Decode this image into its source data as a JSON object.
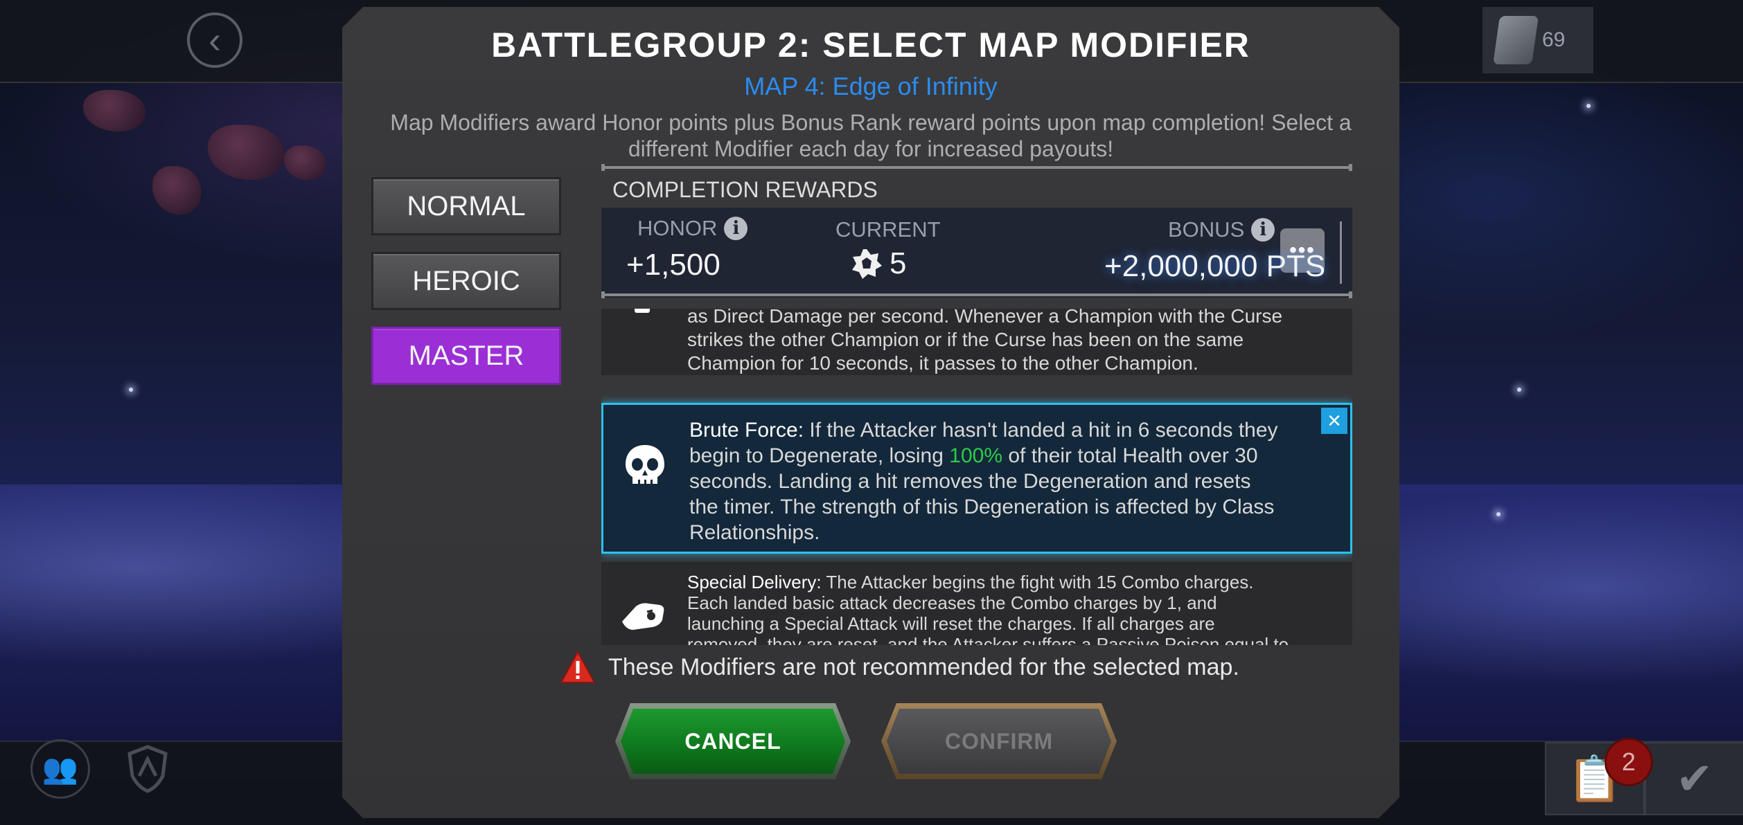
{
  "screen": {
    "resource_count": "69",
    "alert_count": "2"
  },
  "modal": {
    "title": "BATTLEGROUP 2: SELECT MAP MODIFIER",
    "subtitle": "MAP 4: Edge of Infinity",
    "description": "Map Modifiers award Honor points plus Bonus Rank reward points upon map completion! Select a different Modifier each day for increased payouts!",
    "tiers": [
      {
        "label": "NORMAL",
        "active": false
      },
      {
        "label": "HEROIC",
        "active": false
      },
      {
        "label": "MASTER",
        "active": true
      }
    ],
    "tier_active_color": "#9b2fd6"
  },
  "rewards": {
    "heading": "COMPLETION REWARDS",
    "honor_label": "HONOR",
    "honor_value": "+1,500",
    "current_label": "CURRENT",
    "current_value": "5",
    "bonus_label": "BONUS",
    "bonus_value": "+2,000,000 PTS"
  },
  "modifiers": [
    {
      "name": "",
      "text_visible": "as Direct Damage per second. Whenever a Champion with the Curse strikes the other Champion or if the Curse has been on the same Champion for 10 seconds, it passes to the other Champion.",
      "selected": false
    },
    {
      "name": "Brute Force:",
      "text_before": " If the Attacker hasn't landed a hit in 6 seconds they begin to Degenerate, losing ",
      "highlight": "100%",
      "text_after": " of their total Health over 30 seconds. Landing a hit removes the Degeneration and resets the timer. The strength of this Degeneration is affected by Class Relationships.",
      "icon": "skull-icon",
      "selected": true
    },
    {
      "name": "Special Delivery:",
      "text": " The Attacker begins the fight with 15 Combo charges. Each landed basic attack decreases the Combo charges by 1, and launching a Special Attack will reset the charges. If all charges are removed, they are reset, and the Attacker suffers a Passive Poison equal to",
      "icon": "fist-icon",
      "selected": false
    }
  ],
  "warning": {
    "text": "These Modifiers are not recommended for the selected map."
  },
  "actions": {
    "cancel_label": "CANCEL",
    "confirm_label": "CONFIRM"
  },
  "colors": {
    "accent_blue": "#2b8cf0",
    "highlight_green": "#2ccc4a",
    "selected_border": "#2ec0f0",
    "cancel_green": "#1d9a2e"
  }
}
